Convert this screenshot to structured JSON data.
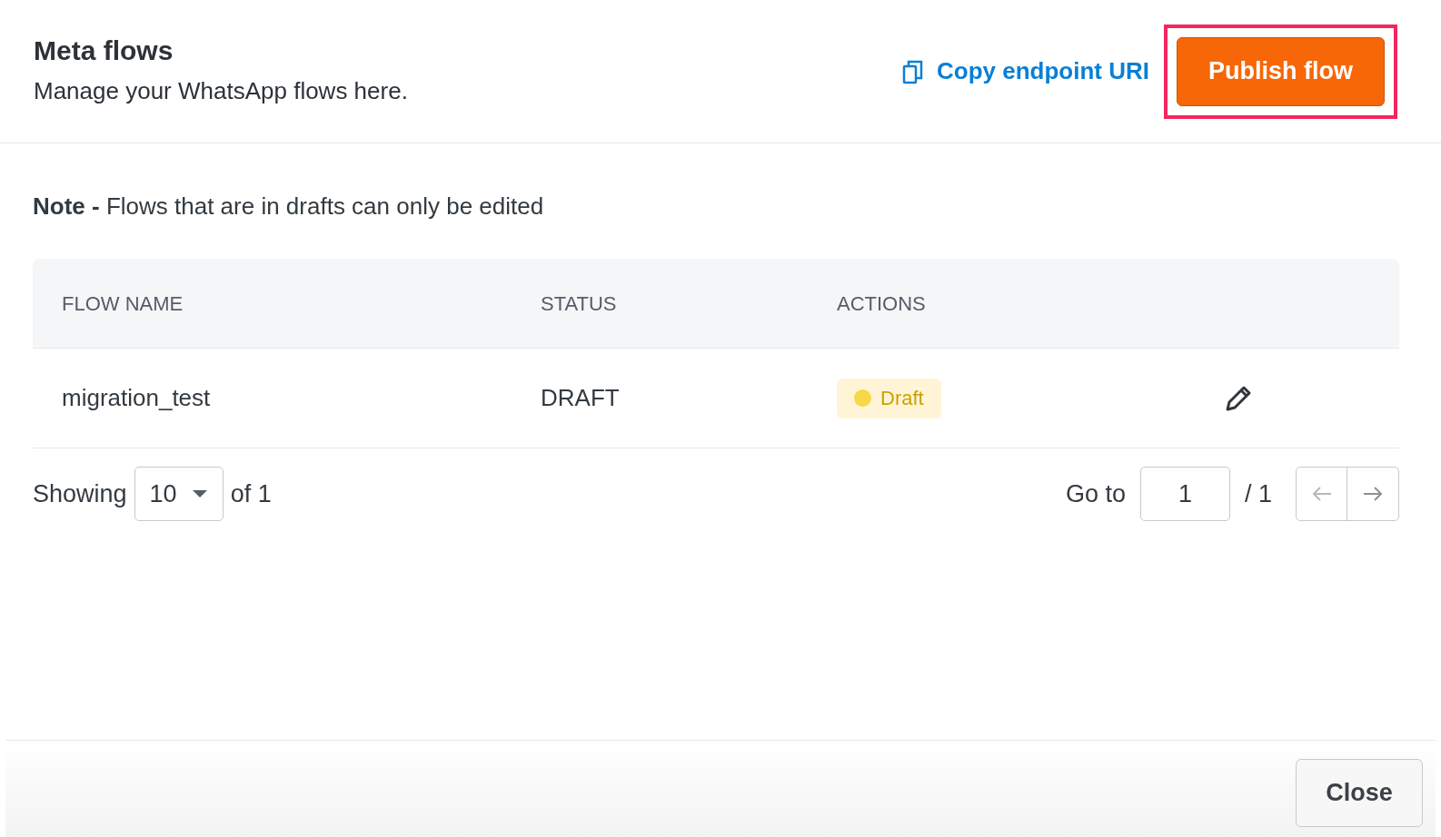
{
  "header": {
    "title": "Meta flows",
    "subtitle": "Manage your WhatsApp flows here.",
    "copy_link": "Copy endpoint URI",
    "publish_button": {
      "label": "Publish flow",
      "highlighted": true
    }
  },
  "note": "**Note -** Flows that are in drafts can only be edited",
  "table": {
    "columns": [
      "FLOW NAME",
      "STATUS",
      "ACTIONS"
    ],
    "rows": [
      {
        "flow_name": "migration_test",
        "status": "DRAFT",
        "badge": {
          "label": "Draft",
          "color": "#f8d849"
        }
      }
    ]
  },
  "pagination": {
    "showing_label": "Showing",
    "page_size": "10",
    "of_label": "of 1",
    "goto_label": "Go to",
    "page": "1",
    "total": "/ 1"
  },
  "footer": {
    "close_button": "Close"
  }
}
